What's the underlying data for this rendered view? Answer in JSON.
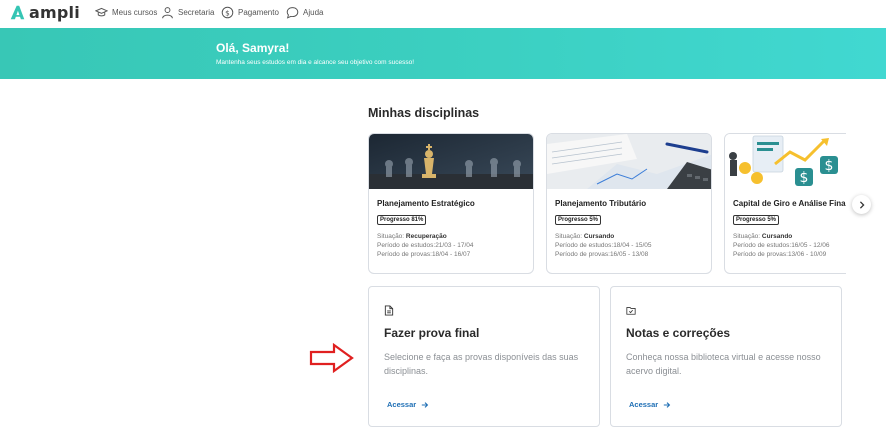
{
  "brand": {
    "name": "ampli",
    "color": "#35c5b4"
  },
  "nav": {
    "items": [
      {
        "label": "Meus cursos",
        "icon": "graduation-cap-icon"
      },
      {
        "label": "Secretaria",
        "icon": "user-icon"
      },
      {
        "label": "Pagamento",
        "icon": "dollar-circle-icon"
      },
      {
        "label": "Ajuda",
        "icon": "chat-bubble-icon"
      }
    ]
  },
  "banner": {
    "title": "Olá, Samyra!",
    "subtitle": "Mantenha seus estudos em dia e alcance seu objetivo com sucesso!"
  },
  "disciplinas": {
    "title": "Minhas disciplinas",
    "cards": [
      {
        "title": "Planejamento Estratégico",
        "progress": "Progresso 81%",
        "situacao_label": "Situação:",
        "situacao": "Recuperação",
        "estudos_label": "Período de estudos:",
        "estudos": "21/03 - 17/04",
        "provas_label": "Período de provas:",
        "provas": "18/04 - 16/07"
      },
      {
        "title": "Planejamento Tributário",
        "progress": "Progresso 5%",
        "situacao_label": "Situação:",
        "situacao": "Cursando",
        "estudos_label": "Período de estudos:",
        "estudos": "18/04 - 15/05",
        "provas_label": "Período de provas:",
        "provas": "16/05 - 13/08"
      },
      {
        "title": "Capital de Giro e Análise Fina",
        "progress": "Progresso 5%",
        "situacao_label": "Situação:",
        "situacao": "Cursando",
        "estudos_label": "Período de estudos:",
        "estudos": "16/05 - 12/06",
        "provas_label": "Período de provas:",
        "provas": "13/06 - 10/09"
      }
    ]
  },
  "actions": [
    {
      "title": "Fazer prova final",
      "description": "Selecione e faça as provas disponíveis das suas disciplinas.",
      "link": "Acessar",
      "icon": "document-icon"
    },
    {
      "title": "Notas e correções",
      "description": "Conheça nossa biblioteca virtual e acesse nosso acervo digital.",
      "link": "Acessar",
      "icon": "folder-check-icon"
    }
  ],
  "annotation": {
    "icon": "red-arrow-icon",
    "color": "#e02020"
  }
}
